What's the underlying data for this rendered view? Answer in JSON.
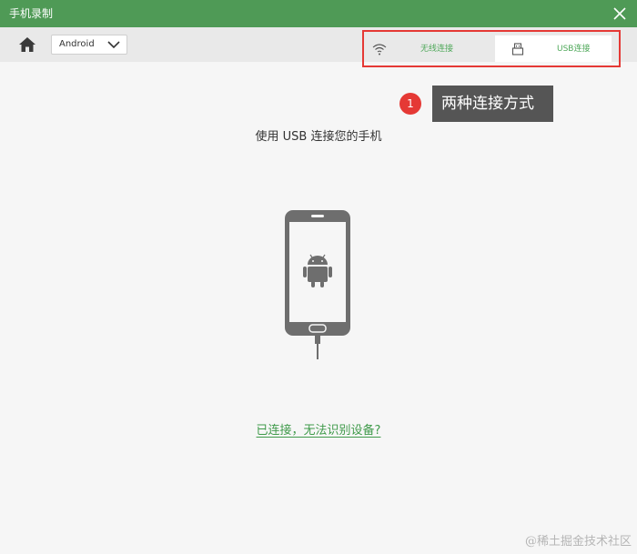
{
  "window": {
    "title": "手机录制"
  },
  "toolbar": {
    "platform_select": {
      "value": "Android"
    }
  },
  "connection_tabs": [
    {
      "label": "无线连接",
      "icon": "wifi-icon",
      "selected": false
    },
    {
      "label": "USB连接",
      "icon": "usb-icon",
      "selected": true
    }
  ],
  "annotation": {
    "number": "1",
    "text": "两种连接方式"
  },
  "main": {
    "instruction": "使用 USB 连接您的手机",
    "help_link": "已连接，无法识别设备?"
  },
  "watermark": "@稀土掘金技术社区",
  "colors": {
    "titlebar": "#4f9a56",
    "accent_green": "#4fa85a",
    "annotation_red": "#e53935",
    "phone_gray": "#6e6e6e"
  }
}
